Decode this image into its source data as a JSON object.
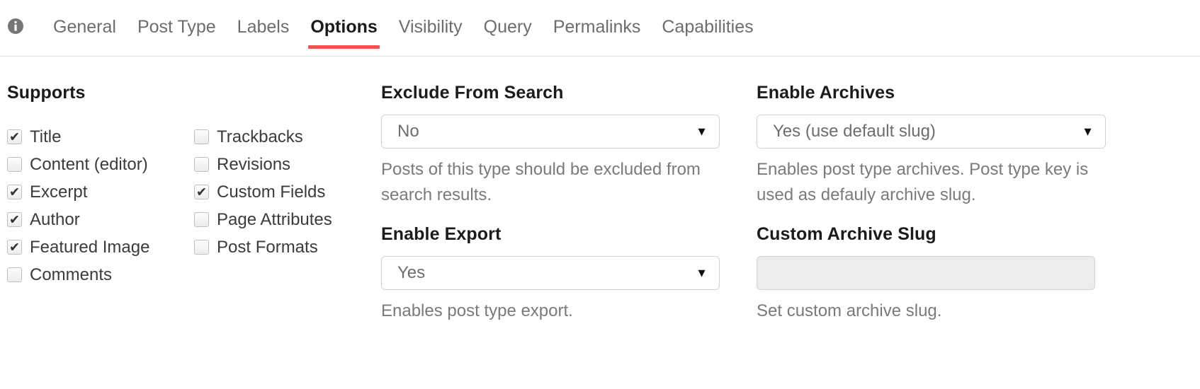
{
  "tabbar": {
    "info_icon": "info-circle-icon",
    "tabs": [
      {
        "label": "General",
        "active": false
      },
      {
        "label": "Post Type",
        "active": false
      },
      {
        "label": "Labels",
        "active": false
      },
      {
        "label": "Options",
        "active": true
      },
      {
        "label": "Visibility",
        "active": false
      },
      {
        "label": "Query",
        "active": false
      },
      {
        "label": "Permalinks",
        "active": false
      },
      {
        "label": "Capabilities",
        "active": false
      }
    ],
    "active_tab": "Options",
    "active_underline_color": "#ef5350"
  },
  "supports": {
    "title": "Supports",
    "column_left": [
      {
        "label": "Title",
        "checked": true
      },
      {
        "label": "Content (editor)",
        "checked": false
      },
      {
        "label": "Excerpt",
        "checked": true
      },
      {
        "label": "Author",
        "checked": true
      },
      {
        "label": "Featured Image",
        "checked": true
      },
      {
        "label": "Comments",
        "checked": false
      }
    ],
    "column_right": [
      {
        "label": "Trackbacks",
        "checked": false
      },
      {
        "label": "Revisions",
        "checked": false
      },
      {
        "label": "Custom Fields",
        "checked": true
      },
      {
        "label": "Page Attributes",
        "checked": false
      },
      {
        "label": "Post Formats",
        "checked": false
      }
    ]
  },
  "middle_column": {
    "exclude_from_search": {
      "title": "Exclude From Search",
      "value": "No",
      "arrow": "▼",
      "help": "Posts of this type should be excluded from search results."
    },
    "enable_export": {
      "title": "Enable Export",
      "value": "Yes",
      "arrow": "▼",
      "help": "Enables post type export."
    }
  },
  "right_column": {
    "enable_archives": {
      "title": "Enable Archives",
      "value": "Yes (use default slug)",
      "arrow": "▼",
      "help": "Enables post type archives. Post type key is used as defauly archive slug."
    },
    "custom_archive_slug": {
      "title": "Custom Archive Slug",
      "value": "",
      "placeholder": "",
      "help": "Set custom archive slug.",
      "disabled": true
    }
  }
}
